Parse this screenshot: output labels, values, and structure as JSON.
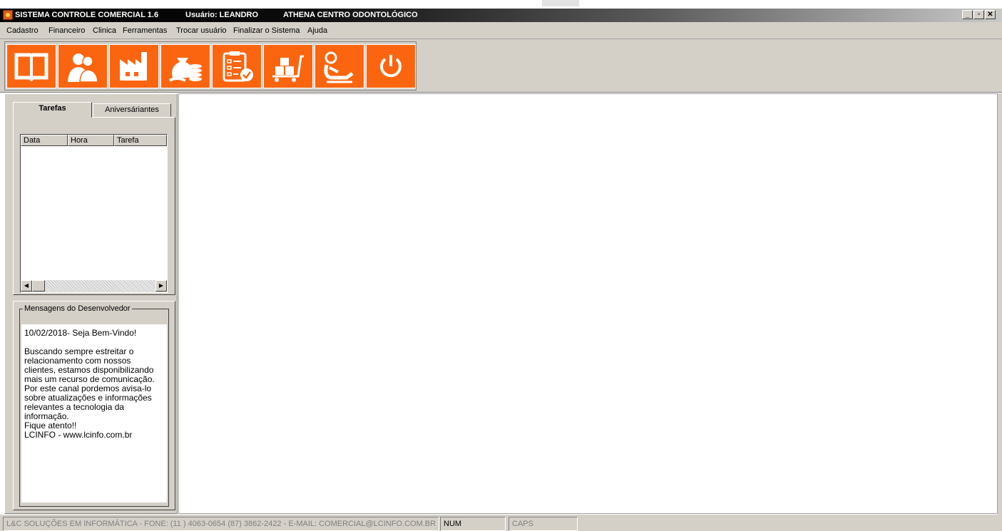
{
  "window": {
    "title": "SISTEMA CONTROLE COMERCIAL 1.6",
    "user": "Usuário: LEANDRO",
    "company": "ATHENA CENTRO ODONTOLÓGICO",
    "controls": {
      "minimize": "_",
      "maximize": "▫",
      "close": "✕"
    }
  },
  "menu": [
    "Cadastro",
    "Financeiro",
    "Clinica",
    "Ferramentas",
    "Trocar usuário",
    "Finalizar o Sistema",
    "Ajuda"
  ],
  "toolbar": {
    "accent": "#fb6510",
    "buttons": [
      {
        "icon": "book-icon"
      },
      {
        "icon": "people-icon"
      },
      {
        "icon": "factory-icon"
      },
      {
        "icon": "money-bag-icon"
      },
      {
        "icon": "checklist-icon"
      },
      {
        "icon": "cart-icon"
      },
      {
        "icon": "patient-chair-icon"
      },
      {
        "icon": "power-icon"
      }
    ]
  },
  "tabs": [
    {
      "label": "Tarefas",
      "active": true
    },
    {
      "label": "Aniversáriantes",
      "active": false
    }
  ],
  "grid": {
    "columns": [
      "Data",
      "Hora",
      "Tarefa"
    ],
    "rows": []
  },
  "messages": {
    "legend": "Mensagens do Desenvolvedor",
    "text": "10/02/2018- Seja Bem-Vindo!\n\nBuscando sempre estreitar o relacionamento com nossos clientes, estamos disponibilizando mais um recurso de comunicação.\nPor este canal pordemos avisa-lo sobre atualizações e informações relevantes a tecnologia da informação.\nFique atento!!\nLCINFO - www.lcinfo.com.br"
  },
  "status": {
    "company_info": "L&C SOLUÇÕES EM INFORMÁTICA - FONE: (11 ) 4063-0654  (87) 3862-2422 - E-MAIL: COMERCIAL@LCINFO.COM.BR",
    "num": "NUM",
    "caps": "CAPS"
  }
}
